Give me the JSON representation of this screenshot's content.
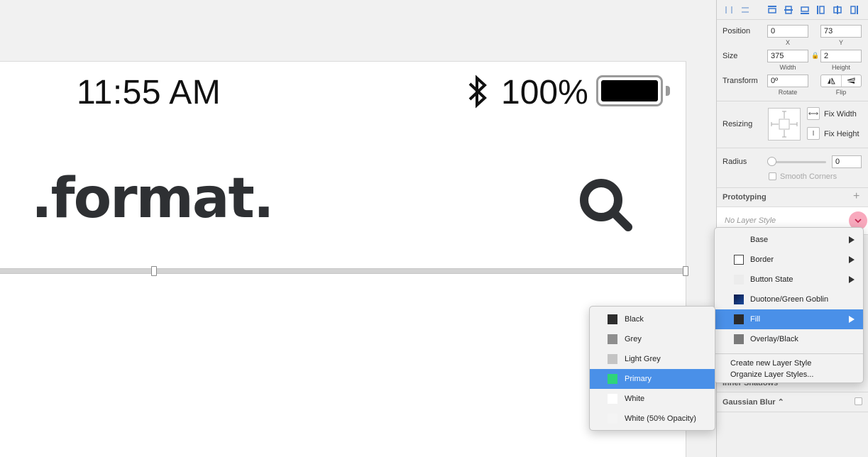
{
  "artboard": {
    "status_time": "11:55 AM",
    "battery_percent": "100%",
    "logo_text": ".format."
  },
  "inspector": {
    "position": {
      "label": "Position",
      "x": "0",
      "y": "73",
      "x_label": "X",
      "y_label": "Y"
    },
    "size": {
      "label": "Size",
      "width": "375",
      "height": "2",
      "width_label": "Width",
      "height_label": "Height"
    },
    "transform": {
      "label": "Transform",
      "rotate": "0º",
      "rotate_label": "Rotate",
      "flip_label": "Flip"
    },
    "resizing": {
      "label": "Resizing",
      "fix_width": "Fix Width",
      "fix_height": "Fix Height"
    },
    "radius": {
      "label": "Radius",
      "value": "0",
      "smooth_corners": "Smooth Corners"
    },
    "prototyping": "Prototyping",
    "layer_style": {
      "placeholder": "No Layer Style"
    },
    "inner_shadows": "Inner Shadows",
    "gaussian_blur": "Gaussian Blur ⌃"
  },
  "style_menu": {
    "items": [
      {
        "label": "Base",
        "swatch": "",
        "submenu": true
      },
      {
        "label": "Border",
        "swatch": "#ffffff",
        "submenu": true,
        "outlined": true
      },
      {
        "label": "Button State",
        "swatch": "#ececec",
        "submenu": true
      },
      {
        "label": "Duotone/Green Goblin",
        "swatch": "#10245a",
        "submenu": false
      },
      {
        "label": "Fill",
        "swatch": "#2b2b2b",
        "submenu": true,
        "selected": true
      },
      {
        "label": "Overlay/Black",
        "swatch": "#7a7a7a",
        "submenu": false
      }
    ],
    "actions": [
      "Create new Layer Style",
      "Organize Layer Styles..."
    ]
  },
  "fill_menu": {
    "items": [
      {
        "label": "Black",
        "swatch": "#2e2e2e"
      },
      {
        "label": "Grey",
        "swatch": "#8e8e8e"
      },
      {
        "label": "Light Grey",
        "swatch": "#c4c4c4"
      },
      {
        "label": "Primary",
        "swatch": "#2ed47a",
        "selected": true
      },
      {
        "label": "White",
        "swatch": "#ffffff"
      },
      {
        "label": "White (50% Opacity)",
        "swatch": "#f4f4f4"
      }
    ]
  },
  "colors": {
    "accent": "#4a90e8",
    "dropdown_badge": "#f8a9bd",
    "logo": "#2e3033"
  }
}
